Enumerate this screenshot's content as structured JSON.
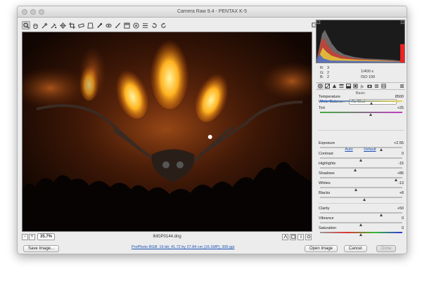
{
  "window": {
    "title": "Camera Raw 9.4  -  PENTAX K-5"
  },
  "toolbar": {
    "tools": [
      {
        "icon": "zoom-icon",
        "active": true
      },
      {
        "icon": "hand-icon"
      },
      {
        "icon": "white-balance-icon"
      },
      {
        "icon": "color-sampler-icon"
      },
      {
        "icon": "targeted-adjustment-icon"
      },
      {
        "icon": "crop-icon"
      },
      {
        "icon": "straighten-icon"
      },
      {
        "icon": "transform-icon"
      },
      {
        "icon": "spot-removal-icon"
      },
      {
        "icon": "red-eye-icon"
      },
      {
        "icon": "adjustment-brush-icon"
      },
      {
        "icon": "graduated-filter-icon"
      },
      {
        "icon": "radial-filter-icon"
      },
      {
        "icon": "preferences-icon"
      },
      {
        "icon": "rotate-ccw-icon"
      },
      {
        "icon": "rotate-cw-icon"
      }
    ]
  },
  "status": {
    "zoom": "35.7%",
    "filename": "IMGP0144.dng"
  },
  "histogram": {
    "r": "3",
    "g": "2",
    "b": "2",
    "r_label": "R:",
    "g_label": "G:",
    "b_label": "B:",
    "shutter": "1/400 s",
    "iso": "ISO 100"
  },
  "panel": {
    "section": "Basic",
    "white_balance_label": "White Balance:",
    "white_balance_value": "As Shot",
    "auto": "Auto",
    "default": "Default",
    "sliders": [
      {
        "label": "Temperature",
        "value": "8500",
        "pos": 0.63,
        "kind": "temp"
      },
      {
        "label": "Tint",
        "value": "+25",
        "pos": 0.62,
        "kind": "tint"
      },
      {
        "label": "Exposure",
        "value": "+2.55",
        "pos": 0.75,
        "kind": "plain"
      },
      {
        "label": "Contrast",
        "value": "0",
        "pos": 0.5,
        "kind": "plain"
      },
      {
        "label": "Highlights",
        "value": "-15",
        "pos": 0.43,
        "kind": "plain"
      },
      {
        "label": "Shadows",
        "value": "+86",
        "pos": 0.93,
        "kind": "plain"
      },
      {
        "label": "Whites",
        "value": "-13",
        "pos": 0.44,
        "kind": "plain"
      },
      {
        "label": "Blacks",
        "value": "+8",
        "pos": 0.54,
        "kind": "plain"
      },
      {
        "label": "Clarity",
        "value": "+50",
        "pos": 0.75,
        "kind": "plain"
      },
      {
        "label": "Vibrance",
        "value": "0",
        "pos": 0.5,
        "kind": "plain"
      },
      {
        "label": "Saturation",
        "value": "0",
        "pos": 0.5,
        "kind": "sat"
      }
    ]
  },
  "footer": {
    "save_label": "Save Image...",
    "workflow_link": "ProPhoto RGB: 16 bit; 41.72 by 27.84 cm (16.1MP); 300 ppi",
    "open_label": "Open Image",
    "cancel_label": "Cancel",
    "done_label": "Done"
  }
}
